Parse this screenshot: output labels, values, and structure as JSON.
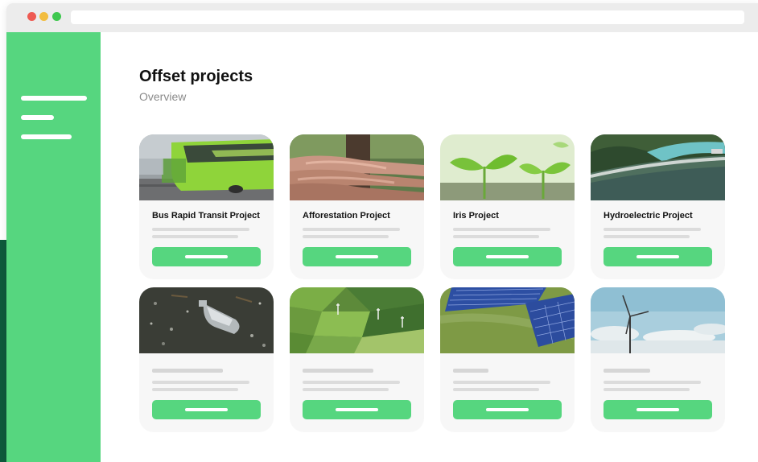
{
  "page": {
    "title": "Offset projects",
    "subtitle": "Overview"
  },
  "projects": [
    {
      "title": "Bus Rapid Transit Project",
      "image": "bus-photo"
    },
    {
      "title": "Afforestation Project",
      "image": "hands-on-tree-photo"
    },
    {
      "title": "Iris Project",
      "image": "seedlings-photo"
    },
    {
      "title": "Hydroelectric Project",
      "image": "dam-river-photo"
    },
    {
      "title": "",
      "image": "plastic-bottle-photo"
    },
    {
      "title": "",
      "image": "farmland-aerial-photo"
    },
    {
      "title": "",
      "image": "solar-panels-photo"
    },
    {
      "title": "",
      "image": "wind-turbine-photo"
    }
  ],
  "colors": {
    "brand_green": "#56d67f",
    "accent_dark_green": "#0e5a3c",
    "card_background": "#f7f7f7",
    "placeholder_gray": "#dcdcdc"
  }
}
